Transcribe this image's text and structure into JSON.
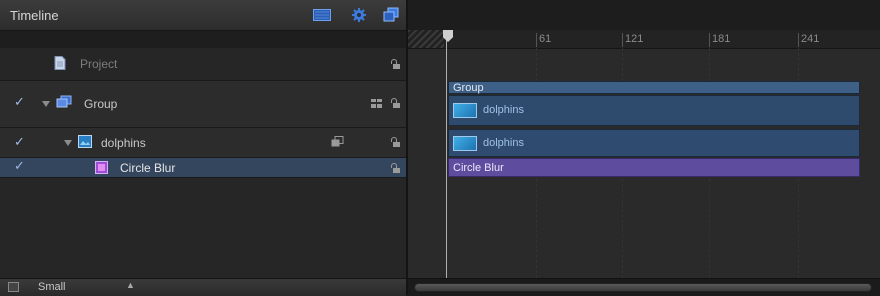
{
  "window": {
    "title": "Timeline"
  },
  "toolbar": {
    "icons": [
      "display-icon",
      "gear-icon",
      "layers-icon"
    ],
    "accent": "#3a78d8"
  },
  "layers": {
    "project": {
      "label": "Project"
    },
    "group": {
      "label": "Group",
      "checked": true
    },
    "dolphins": {
      "label": "dolphins",
      "checked": true
    },
    "circle_blur": {
      "label": "Circle Blur",
      "checked": true,
      "selected": true
    }
  },
  "footer": {
    "size_label": "Small"
  },
  "ruler": {
    "ticks": [
      "61",
      "121",
      "181",
      "241"
    ]
  },
  "tracks": {
    "group_header": "Group",
    "group_bar": "dolphins",
    "dolphins_bar": "dolphins",
    "circle_blur_bar": "Circle Blur"
  },
  "colors": {
    "group_header": "#3e5f86",
    "clip_bar": "#2e4a6d",
    "filter_bar": "#5e4c9e",
    "selection": "#34465e"
  }
}
